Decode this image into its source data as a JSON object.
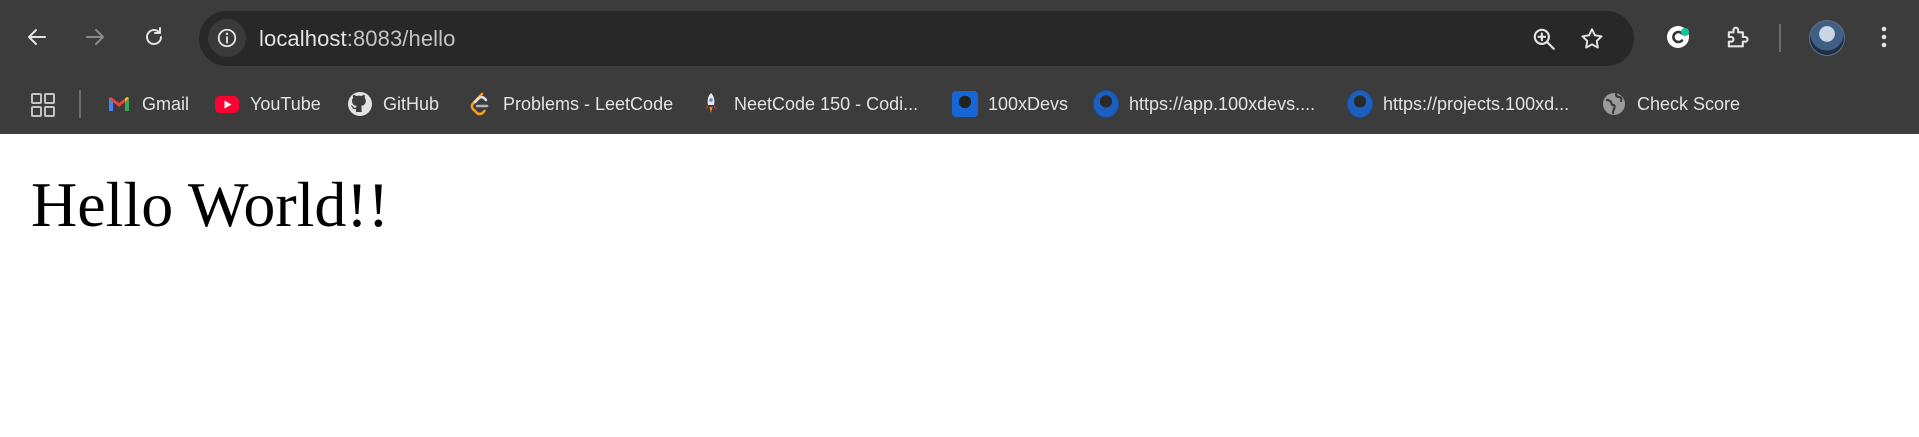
{
  "browser": {
    "url_host": "localhost",
    "url_rest": ":8083/hello",
    "colors": {
      "chrome": "#3c3c3c",
      "omnibox": "#282828",
      "text": "#e3e3e3"
    },
    "toolbar_icons": [
      "back-icon",
      "forward-icon",
      "reload-icon",
      "site-info-icon",
      "zoom-icon",
      "bookmark-star-icon",
      "grammarly-icon",
      "extensions-icon",
      "profile-avatar",
      "menu-icon"
    ]
  },
  "bookmarks": {
    "items": [
      {
        "label": "Gmail",
        "icon": "gmail-icon"
      },
      {
        "label": "YouTube",
        "icon": "youtube-icon"
      },
      {
        "label": "GitHub",
        "icon": "github-icon"
      },
      {
        "label": "Problems - LeetCode",
        "icon": "leetcode-icon"
      },
      {
        "label": "NeetCode 150 - Codi...",
        "icon": "rocket-icon"
      },
      {
        "label": "100xDevs",
        "icon": "100xdevs-icon"
      },
      {
        "label": "https://app.100xdevs....",
        "icon": "profile-photo-icon"
      },
      {
        "label": "https://projects.100xd...",
        "icon": "profile-photo-icon"
      },
      {
        "label": "Check Score",
        "icon": "globe-icon"
      }
    ]
  },
  "page": {
    "heading": "Hello World!!"
  }
}
